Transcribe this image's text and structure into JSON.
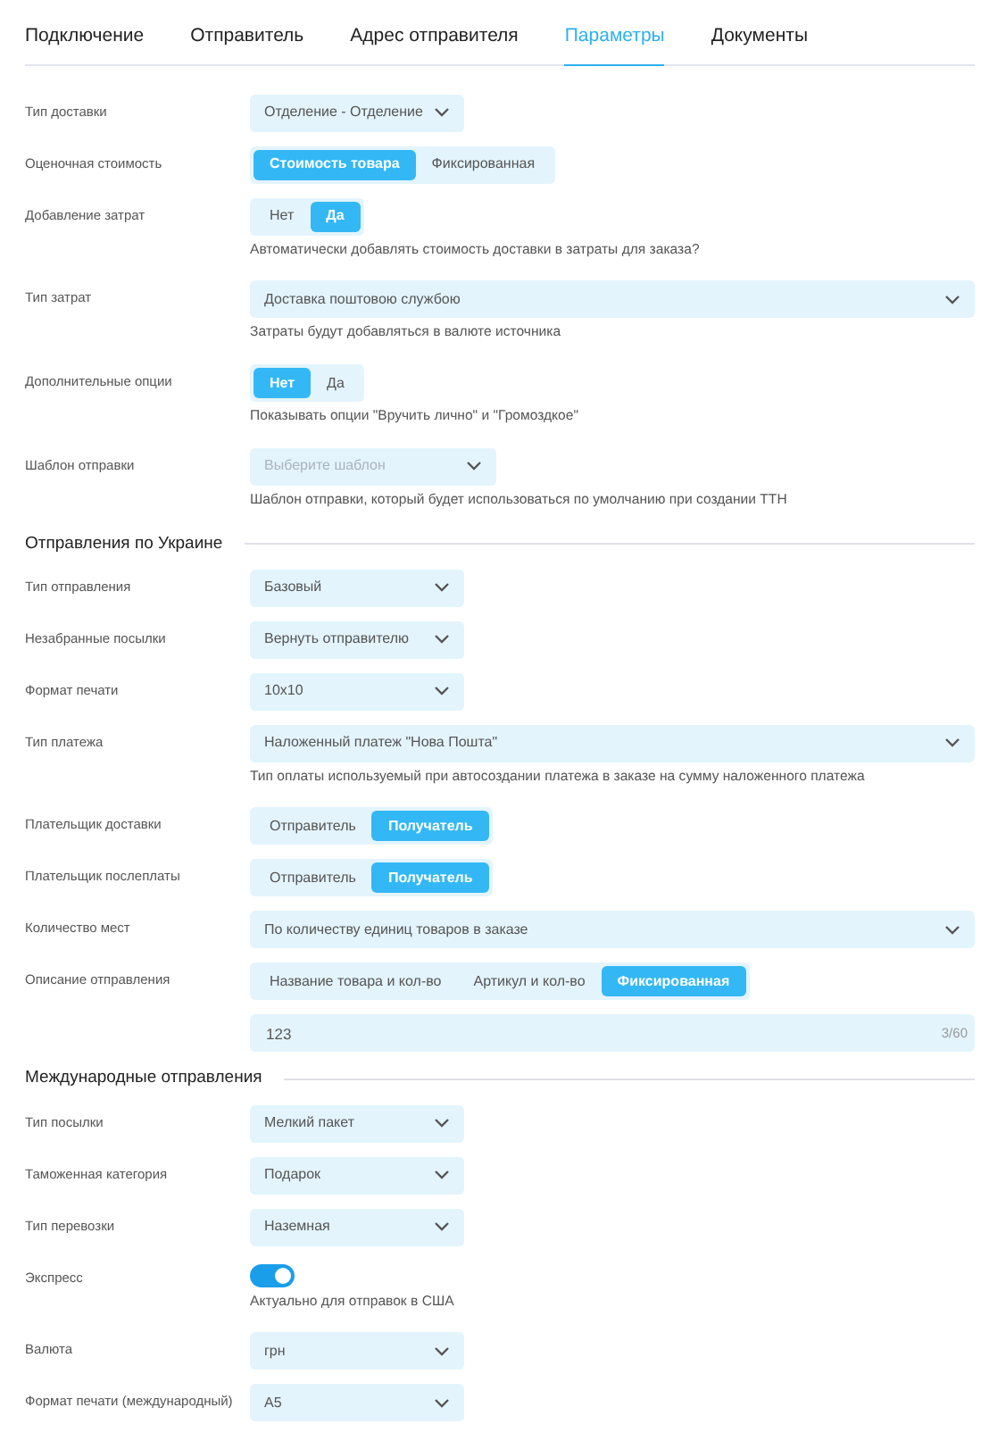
{
  "tabs": [
    {
      "label": "Подключение",
      "selected": false
    },
    {
      "label": "Отправитель",
      "selected": false
    },
    {
      "label": "Адрес отправителя",
      "selected": false
    },
    {
      "label": "Параметры",
      "selected": true
    },
    {
      "label": "Документы",
      "selected": false
    }
  ],
  "sections": [
    {
      "rows": [
        {
          "label": "Тип доставки",
          "kind": "select",
          "value": "Отделение - Отделение",
          "wide": false
        },
        {
          "label": "Оценочная стоимость",
          "kind": "segmented",
          "options": [
            {
              "label": "Стоимость товара",
              "selected": true
            },
            {
              "label": "Фиксированная",
              "selected": false
            }
          ]
        },
        {
          "label": "Добавление затрат",
          "kind": "segmented",
          "options": [
            {
              "label": "Нет",
              "selected": false
            },
            {
              "label": "Да",
              "selected": true
            }
          ],
          "hint": "Автоматически добавлять стоимость доставки в затраты для заказа?"
        },
        {
          "label": "Тип затрат",
          "kind": "select",
          "value": "Доставка поштовою службою",
          "wide": true,
          "hint": "Затраты будут добавляться в валюте источника"
        },
        {
          "label": "Дополнительные опции",
          "kind": "segmented",
          "options": [
            {
              "label": "Нет",
              "selected": true
            },
            {
              "label": "Да",
              "selected": false
            }
          ],
          "hint": "Показывать опции \"Вручить лично\" и \"Громоздкое\""
        },
        {
          "label": "Шаблон отправки",
          "kind": "select",
          "placeholder": "Выберите шаблон",
          "wide": false,
          "hint": "Шаблон отправки, который будет использоваться по умолчанию при создании ТТН"
        }
      ]
    },
    {
      "title": "Отправления по Украине",
      "rows": [
        {
          "label": "Тип отправления",
          "kind": "select",
          "value": "Базовый",
          "wide": false
        },
        {
          "label": "Незабранные посылки",
          "kind": "select",
          "value": "Вернуть отправителю",
          "wide": false
        },
        {
          "label": "Формат печати",
          "kind": "select",
          "value": "10x10",
          "wide": false
        },
        {
          "label": "Тип платежа",
          "kind": "select",
          "value": "Наложенный платеж \"Нова Пошта\"",
          "wide": true,
          "hint": "Тип оплаты используемый при автосоздании платежа в заказе на сумму наложенного платежа"
        },
        {
          "label": "Плательщик доставки",
          "kind": "segmented",
          "options": [
            {
              "label": "Отправитель",
              "selected": false
            },
            {
              "label": "Получатель",
              "selected": true
            }
          ]
        },
        {
          "label": "Плательщик послеплаты",
          "kind": "segmented",
          "options": [
            {
              "label": "Отправитель",
              "selected": false
            },
            {
              "label": "Получатель",
              "selected": true
            }
          ]
        },
        {
          "label": "Количество мест",
          "kind": "select",
          "value": "По количеству единиц товаров в заказе",
          "wide": true
        },
        {
          "label": "Описание отправления",
          "kind": "segmented",
          "options": [
            {
              "label": "Название товара и кол-во",
              "selected": false
            },
            {
              "label": "Артикул и кол-во",
              "selected": false
            },
            {
              "label": "Фиксированная",
              "selected": true
            }
          ]
        },
        {
          "kind": "text",
          "value": "123",
          "counter": "3/60"
        }
      ]
    },
    {
      "title": "Международные отправления",
      "rows": [
        {
          "label": "Тип посылки",
          "kind": "select",
          "value": "Мелкий пакет",
          "wide": false
        },
        {
          "label": "Таможенная категория",
          "kind": "select",
          "value": "Подарок",
          "wide": false
        },
        {
          "label": "Тип перевозки",
          "kind": "select",
          "value": "Наземная",
          "wide": false
        },
        {
          "label": "Экспресс",
          "kind": "toggle",
          "on": true,
          "hint": "Актуально для отправок в США"
        },
        {
          "label": "Валюта",
          "kind": "select",
          "value": "грн",
          "wide": false
        },
        {
          "label": "Формат печати (международный)",
          "kind": "select",
          "value": "А5",
          "wide": false
        }
      ]
    }
  ]
}
